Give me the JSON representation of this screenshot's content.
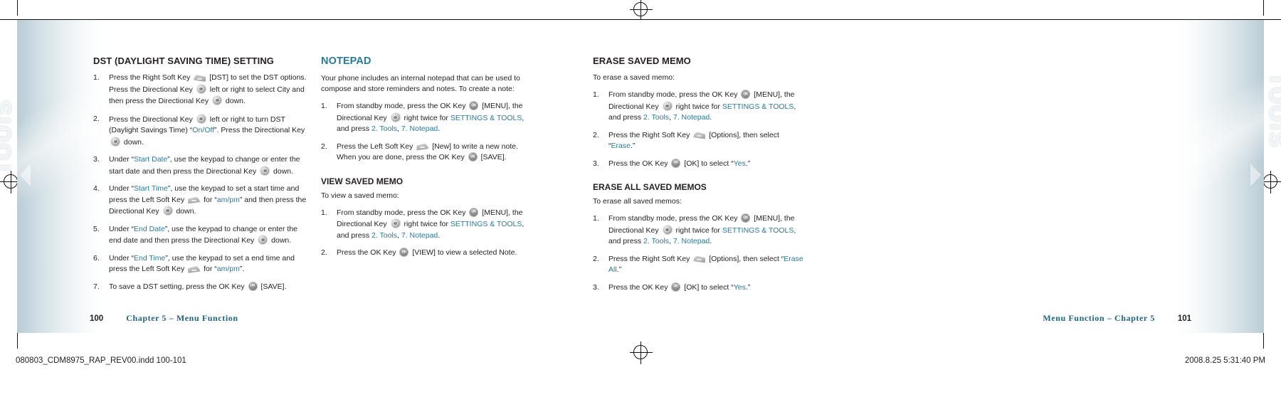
{
  "document": {
    "side_tab_label": "Tools",
    "left_page_number": "100",
    "right_page_number": "101",
    "left_footer_chapter": "Chapter 5 – Menu Function",
    "right_footer_chapter": "Menu Function – Chapter 5",
    "slug_file": "080803_CDM8975_RAP_REV00.indd   100-101",
    "slug_datetime": "2008.8.25   5:31:40 PM",
    "accent_color": "#2a7a96",
    "footer_color": "#20647d",
    "text_color": "#231f20"
  },
  "column_left": {
    "heading": "DST (DAYLIGHT SAVING TIME) SETTING",
    "steps": [
      {
        "num": "1.",
        "parts": [
          {
            "t": "Press the Right Soft Key ",
            "s": "plain"
          },
          {
            "t": "right-soft-key",
            "s": "icon"
          },
          {
            "t": " [DST] to set the DST options. Press the Directional Key ",
            "s": "plain"
          },
          {
            "t": "directional-key",
            "s": "icon"
          },
          {
            "t": " left or right to select City and then press the Directional Key ",
            "s": "plain"
          },
          {
            "t": "directional-key",
            "s": "icon"
          },
          {
            "t": " down.",
            "s": "plain"
          }
        ]
      },
      {
        "num": "2.",
        "parts": [
          {
            "t": "Press the Directional Key ",
            "s": "plain"
          },
          {
            "t": "directional-key",
            "s": "icon"
          },
          {
            "t": " left or right to turn DST (Daylight Savings Time) “",
            "s": "plain"
          },
          {
            "t": "On/Off",
            "s": "teal"
          },
          {
            "t": "”. Press the Directional Key ",
            "s": "plain"
          },
          {
            "t": "directional-key",
            "s": "icon"
          },
          {
            "t": " down.",
            "s": "plain"
          }
        ]
      },
      {
        "num": "3.",
        "parts": [
          {
            "t": "Under “",
            "s": "plain"
          },
          {
            "t": "Start Date",
            "s": "teal"
          },
          {
            "t": "”, use the keypad to change or enter the start date and then press the Directional Key ",
            "s": "plain"
          },
          {
            "t": "directional-key",
            "s": "icon"
          },
          {
            "t": " down.",
            "s": "plain"
          }
        ]
      },
      {
        "num": "4.",
        "parts": [
          {
            "t": "Under “",
            "s": "plain"
          },
          {
            "t": "Start Time",
            "s": "teal"
          },
          {
            "t": "”, use the keypad to set a start time and press the Left Soft Key ",
            "s": "plain"
          },
          {
            "t": "left-soft-key",
            "s": "icon"
          },
          {
            "t": " for “",
            "s": "plain"
          },
          {
            "t": "am/pm",
            "s": "teal"
          },
          {
            "t": "” and then press the Directional Key ",
            "s": "plain"
          },
          {
            "t": "directional-key",
            "s": "icon"
          },
          {
            "t": " down.",
            "s": "plain"
          }
        ]
      },
      {
        "num": "5.",
        "parts": [
          {
            "t": "Under “",
            "s": "plain"
          },
          {
            "t": "End Date",
            "s": "teal"
          },
          {
            "t": "”, use the keypad to change or enter the end date and then press the Directional Key ",
            "s": "plain"
          },
          {
            "t": "directional-key",
            "s": "icon"
          },
          {
            "t": " down.",
            "s": "plain"
          }
        ]
      },
      {
        "num": "6.",
        "parts": [
          {
            "t": "Under “",
            "s": "plain"
          },
          {
            "t": "End Time",
            "s": "teal"
          },
          {
            "t": "”, use the keypad to set a end time and press the Left Soft Key ",
            "s": "plain"
          },
          {
            "t": "left-soft-key",
            "s": "icon"
          },
          {
            "t": " for “",
            "s": "plain"
          },
          {
            "t": "am/pm",
            "s": "teal"
          },
          {
            "t": "”.",
            "s": "plain"
          }
        ]
      },
      {
        "num": "7.",
        "parts": [
          {
            "t": "To save a DST setting, press the OK Key ",
            "s": "plain"
          },
          {
            "t": "ok-key",
            "s": "icon"
          },
          {
            "t": " [SAVE].",
            "s": "plain"
          }
        ]
      }
    ]
  },
  "column_middle": {
    "heading": "NOTEPAD",
    "lead": "Your phone includes an internal notepad that can be used to compose and store reminders and notes. To create a note:",
    "steps": [
      {
        "num": "1.",
        "parts": [
          {
            "t": "From standby mode, press the OK Key ",
            "s": "plain"
          },
          {
            "t": "ok-key",
            "s": "icon"
          },
          {
            "t": " [MENU], the Directional Key ",
            "s": "plain"
          },
          {
            "t": "directional-key",
            "s": "icon"
          },
          {
            "t": " right twice for ",
            "s": "plain"
          },
          {
            "t": "SETTINGS & TOOLS",
            "s": "teal"
          },
          {
            "t": ", and press ",
            "s": "plain"
          },
          {
            "t": "2. Tools",
            "s": "teal"
          },
          {
            "t": ", ",
            "s": "plain"
          },
          {
            "t": "7. Notepad",
            "s": "teal"
          },
          {
            "t": ".",
            "s": "plain"
          }
        ]
      },
      {
        "num": "2.",
        "parts": [
          {
            "t": "Press the Left Soft Key ",
            "s": "plain"
          },
          {
            "t": "left-soft-key",
            "s": "icon"
          },
          {
            "t": " [New] to write a new note. When you are done, press the OK Key ",
            "s": "plain"
          },
          {
            "t": "ok-key",
            "s": "icon"
          },
          {
            "t": " [SAVE].",
            "s": "plain"
          }
        ]
      }
    ],
    "subsection": {
      "heading": "VIEW SAVED MEMO",
      "lead": "To view a saved memo:",
      "steps": [
        {
          "num": "1.",
          "parts": [
            {
              "t": "From standby mode, press the OK Key ",
              "s": "plain"
            },
            {
              "t": "ok-key",
              "s": "icon"
            },
            {
              "t": " [MENU], the Directional Key ",
              "s": "plain"
            },
            {
              "t": "directional-key",
              "s": "icon"
            },
            {
              "t": " right twice for ",
              "s": "plain"
            },
            {
              "t": "SETTINGS & TOOLS",
              "s": "teal"
            },
            {
              "t": ", and press ",
              "s": "plain"
            },
            {
              "t": "2. Tools",
              "s": "teal"
            },
            {
              "t": ", ",
              "s": "plain"
            },
            {
              "t": "7. Notepad",
              "s": "teal"
            },
            {
              "t": ".",
              "s": "plain"
            }
          ]
        },
        {
          "num": "2.",
          "parts": [
            {
              "t": "Press the OK Key ",
              "s": "plain"
            },
            {
              "t": "ok-key",
              "s": "icon"
            },
            {
              "t": " [VIEW] to view a selected Note.",
              "s": "plain"
            }
          ]
        }
      ]
    }
  },
  "column_right": {
    "section_a": {
      "heading": "ERASE SAVED MEMO",
      "lead": "To erase a saved memo:",
      "steps": [
        {
          "num": "1.",
          "parts": [
            {
              "t": "From standby mode, press the OK Key ",
              "s": "plain"
            },
            {
              "t": "ok-key",
              "s": "icon"
            },
            {
              "t": " [MENU], the Directional Key ",
              "s": "plain"
            },
            {
              "t": "directional-key",
              "s": "icon"
            },
            {
              "t": " right twice for ",
              "s": "plain"
            },
            {
              "t": "SETTINGS & TOOLS",
              "s": "teal"
            },
            {
              "t": ", and press ",
              "s": "plain"
            },
            {
              "t": "2. Tools",
              "s": "teal"
            },
            {
              "t": ", ",
              "s": "plain"
            },
            {
              "t": "7. Notepad",
              "s": "teal"
            },
            {
              "t": ".",
              "s": "plain"
            }
          ]
        },
        {
          "num": "2.",
          "parts": [
            {
              "t": "Press the Right Soft Key ",
              "s": "plain"
            },
            {
              "t": "right-soft-key",
              "s": "icon"
            },
            {
              "t": " [Options], then select “",
              "s": "plain"
            },
            {
              "t": "Erase",
              "s": "teal"
            },
            {
              "t": ".”",
              "s": "plain"
            }
          ]
        },
        {
          "num": "3.",
          "parts": [
            {
              "t": "Press the OK Key ",
              "s": "plain"
            },
            {
              "t": "ok-key",
              "s": "icon"
            },
            {
              "t": " [OK] to select “",
              "s": "plain"
            },
            {
              "t": "Yes",
              "s": "teal"
            },
            {
              "t": ".”",
              "s": "plain"
            }
          ]
        }
      ]
    },
    "section_b": {
      "heading": "ERASE ALL SAVED MEMOS",
      "lead": "To erase all saved memos:",
      "steps": [
        {
          "num": "1.",
          "parts": [
            {
              "t": "From standby mode, press the OK Key ",
              "s": "plain"
            },
            {
              "t": "ok-key",
              "s": "icon"
            },
            {
              "t": " [MENU], the Directional Key ",
              "s": "plain"
            },
            {
              "t": "directional-key",
              "s": "icon"
            },
            {
              "t": " right twice for ",
              "s": "plain"
            },
            {
              "t": "SETTINGS & TOOLS",
              "s": "teal"
            },
            {
              "t": ", and press ",
              "s": "plain"
            },
            {
              "t": "2. Tools",
              "s": "teal"
            },
            {
              "t": ", ",
              "s": "plain"
            },
            {
              "t": "7. Notepad",
              "s": "teal"
            },
            {
              "t": ".",
              "s": "plain"
            }
          ]
        },
        {
          "num": "2.",
          "parts": [
            {
              "t": "Press the Right Soft Key ",
              "s": "plain"
            },
            {
              "t": "right-soft-key",
              "s": "icon"
            },
            {
              "t": " [Options], then select “",
              "s": "plain"
            },
            {
              "t": "Erase All",
              "s": "teal"
            },
            {
              "t": ".”",
              "s": "plain"
            }
          ]
        },
        {
          "num": "3.",
          "parts": [
            {
              "t": "Press the OK Key ",
              "s": "plain"
            },
            {
              "t": "ok-key",
              "s": "icon"
            },
            {
              "t": " [OK] to select “",
              "s": "plain"
            },
            {
              "t": "Yes",
              "s": "teal"
            },
            {
              "t": ".”",
              "s": "plain"
            }
          ]
        }
      ]
    }
  }
}
